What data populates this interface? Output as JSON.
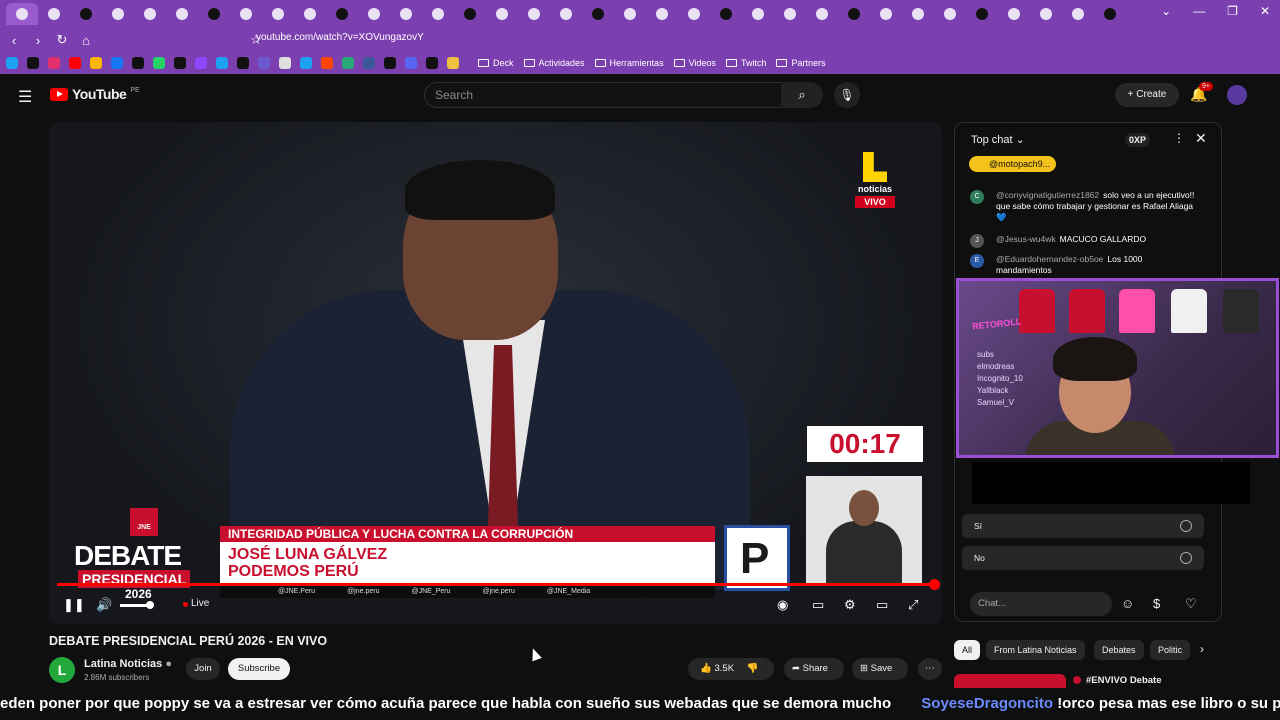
{
  "browser": {
    "tab_count": 35,
    "address": "youtube.com/watch?v=XOVungazovY",
    "bookmarks": [
      "Deck",
      "Actividades",
      "Herramientas",
      "Videos",
      "Twitch",
      "Partners"
    ]
  },
  "youtube": {
    "logo": "YouTube",
    "country": "PE",
    "search_placeholder": "Search",
    "create_label": "Create",
    "notif_badge": "9+"
  },
  "video": {
    "bug_text": "noticias",
    "bug_vivo": "VIVO",
    "timer": "00:17",
    "jne": "JNE",
    "debate": "DEBATE",
    "presidencial": "PRESIDENCIAL",
    "year": "2026",
    "topic": "INTEGRIDAD PÚBLICA Y LUCHA CONTRA LA CORRUPCIÓN",
    "name": "JOSÉ LUNA GÁLVEZ",
    "party": "PODEMOS PERÚ",
    "party_letter": "P",
    "socials": [
      "@JNE.Peru",
      "@jne.peru",
      "@JNE_Peru",
      "@jne.peru",
      "@JNE_Media"
    ],
    "live_label": "Live",
    "progress": 1.0
  },
  "meta": {
    "title": "DEBATE PRESIDENCIAL PERÚ 2026 - EN VIVO",
    "channel": "Latina Noticias",
    "channel_initial": "L",
    "subscribers": "2.86M subscribers",
    "join": "Join",
    "subscribe": "Subscribe",
    "likes": "3.5K",
    "share": "Share",
    "save": "Save"
  },
  "chat": {
    "mode": "Top chat",
    "xp": "0XP",
    "pinned": "@motopach9...",
    "messages": [
      {
        "initial": "C",
        "color": "#2e7d5b",
        "user": "@conyvignatigutierrez1862",
        "text": "solo veo a un ejecutivo!! que sabe cómo trabajar y gestionar es Rafael Aliaga 💙"
      },
      {
        "initial": "J",
        "color": "#555555",
        "user": "@Jesus-wu4wk",
        "text": "MACUCO GALLARDO"
      },
      {
        "initial": "E",
        "color": "#2b5aa8",
        "user": "@Eduardohernandez-ob5oe",
        "text": "Los 1000 mandamientos"
      }
    ],
    "webcam_tag": "RETOROLL",
    "webcam_names": [
      "subs",
      "elmodreas",
      "Incognito_10",
      "Yallblack",
      "Samuel_V"
    ],
    "poll_options": [
      "Sí",
      "No"
    ],
    "input_placeholder": "Chat..."
  },
  "chips": [
    "All",
    "From Latina Noticias",
    "Debates",
    "Politic"
  ],
  "recommendation": "#ENVIVO Debate",
  "ticker": {
    "text_a": "eden poner por que poppy se va a estresar ver cómo acuña parece que habla con sueño sus webadas que se demora mucho",
    "user": "SoyeseDragoncito",
    "text_b": "!orco pesa mas ese libro o su papada?"
  },
  "colors": {
    "browser_purple": "#7b3fb0",
    "yt_red": "#ff0000",
    "debate_red": "#c8102e",
    "webcam_border": "#9b4fd8",
    "pinned_gold": "#f4c21a"
  }
}
